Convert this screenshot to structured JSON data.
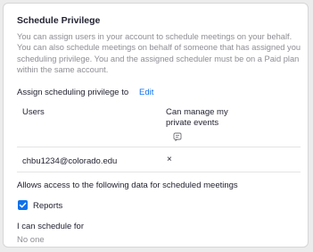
{
  "section": {
    "title": "Schedule Privilege",
    "description": "You can assign users in your account to schedule meetings on your behalf. You can also schedule meetings on behalf of someone that has assigned you scheduling privilege. You and the assigned scheduler must be on a Paid plan within the same account."
  },
  "assign": {
    "label": "Assign scheduling privilege to",
    "edit_label": "Edit"
  },
  "table": {
    "columns": {
      "users": "Users",
      "manage": "Can manage my private events"
    },
    "info_icon": "info-icon",
    "rows": [
      {
        "user": "chbu1234@colorado.edu",
        "manage_mark": "×"
      }
    ]
  },
  "access": {
    "label": "Allows access to the following data for scheduled meetings",
    "options": [
      {
        "label": "Reports",
        "checked": true
      }
    ]
  },
  "schedule_for": {
    "label": "I can schedule for",
    "value": "No one"
  },
  "colors": {
    "accent": "#0e72ed",
    "text": "#232333",
    "muted": "#8e8e95"
  }
}
